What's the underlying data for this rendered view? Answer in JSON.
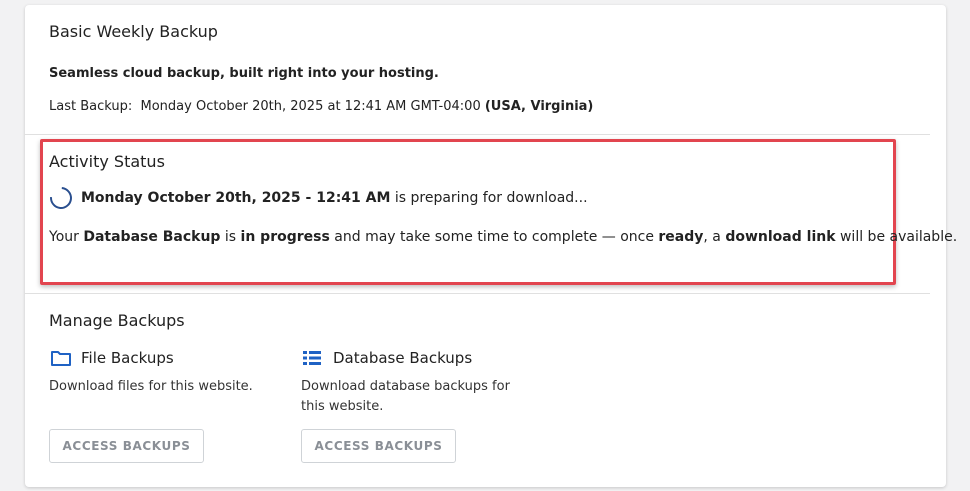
{
  "backup": {
    "title": "Basic Weekly Backup",
    "tagline": "Seamless cloud backup, built right into your hosting.",
    "last_backup_label": "Last Backup:",
    "last_backup_value": "Monday October 20th, 2025 at 12:41 AM GMT-04:00",
    "last_backup_location": "(USA, Virginia)"
  },
  "activity": {
    "title": "Activity Status",
    "status_date": "Monday October 20th, 2025 - 12:41 AM",
    "status_text": "is preparing for download...",
    "msg_your": "Your",
    "msg_db_backup": "Database Backup",
    "msg_is": "is",
    "msg_in_progress": "in progress",
    "msg_mid": "and may take some time to complete — once",
    "msg_ready": "ready",
    "msg_a": ", a",
    "msg_download_link": "download link",
    "msg_end": "will be available."
  },
  "manage": {
    "title": "Manage Backups",
    "file": {
      "title": "File Backups",
      "description": "Download files for this website.",
      "button": "ACCESS BACKUPS",
      "icon": "folder-icon"
    },
    "database": {
      "title": "Database Backups",
      "description": "Download database backups for this website.",
      "button": "ACCESS BACKUPS",
      "icon": "database-list-icon"
    }
  },
  "colors": {
    "highlight_border": "#e2454f",
    "icon_blue": "#1f62c4",
    "spinner": "#2a4f8f"
  }
}
